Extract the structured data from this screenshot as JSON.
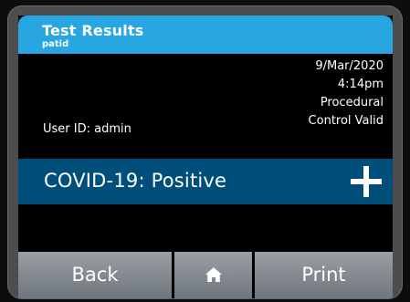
{
  "header": {
    "title": "Test Results",
    "subtitle": "patid"
  },
  "info": {
    "date": "9/Mar/2020",
    "time": "4:14pm",
    "status_line1": "Procedural",
    "status_line2": "Control Valid",
    "user_id": "User ID: admin"
  },
  "result": {
    "text": "COVID-19: Positive",
    "icon": "plus-icon"
  },
  "footer": {
    "back_label": "Back",
    "home_icon": "home-icon",
    "print_label": "Print"
  },
  "colors": {
    "header": "#27a6e2",
    "result_bar": "#004f7b",
    "button_top": "#9aa0a5",
    "button_bottom": "#6f767b",
    "text": "#ffffff"
  }
}
